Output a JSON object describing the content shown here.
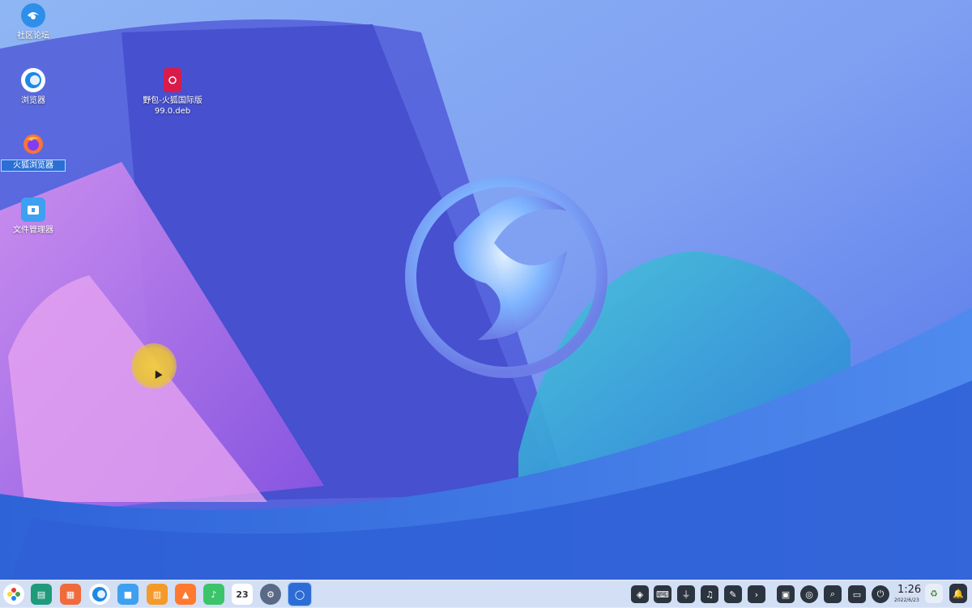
{
  "desktop": {
    "icons": [
      {
        "label": "社区论坛",
        "icon": "deepin-forum-icon",
        "color": "#2f8fe8"
      },
      {
        "label": "浏览器",
        "icon": "browser-icon",
        "color": "#1e88e5"
      },
      {
        "label": "火狐浏览器",
        "icon": "firefox-icon",
        "color": "#ff7139"
      },
      {
        "label": "文件管理器",
        "icon": "file-manager-icon",
        "color": "#3ea0f0"
      },
      {
        "label": "野包-火狐国际版\n99.0.deb",
        "icon": "deb-package-icon",
        "color": "#d81b4a"
      }
    ],
    "selected_label": "火狐浏览器"
  },
  "taskbar": {
    "dock": [
      {
        "icon": "launcher-icon"
      },
      {
        "icon": "multitask-view-icon"
      },
      {
        "icon": "app-store-icon"
      },
      {
        "icon": "browser-icon"
      },
      {
        "icon": "file-manager-icon"
      },
      {
        "icon": "archive-icon"
      },
      {
        "icon": "image-viewer-icon"
      },
      {
        "icon": "music-icon"
      },
      {
        "icon": "calendar-icon",
        "text": "23"
      },
      {
        "icon": "settings-gear-icon"
      },
      {
        "icon": "deepin-id-icon"
      }
    ],
    "tray": [
      {
        "icon": "system-monitor-icon"
      },
      {
        "icon": "keyboard-icon"
      },
      {
        "icon": "usb-icon"
      },
      {
        "icon": "volume-icon"
      },
      {
        "icon": "pen-icon"
      },
      {
        "icon": "chevron-right-icon"
      },
      {
        "icon": "screenshot-icon"
      },
      {
        "icon": "network-icon"
      },
      {
        "icon": "search-icon"
      },
      {
        "icon": "notification-panel-icon"
      },
      {
        "icon": "power-icon"
      }
    ],
    "clock": {
      "time": "1:26",
      "date": "2022/6/23"
    }
  },
  "colors": {
    "accent": "#2b6fd6",
    "wallpaper_primary": "#5a63e0",
    "wallpaper_secondary": "#b56ae3"
  }
}
